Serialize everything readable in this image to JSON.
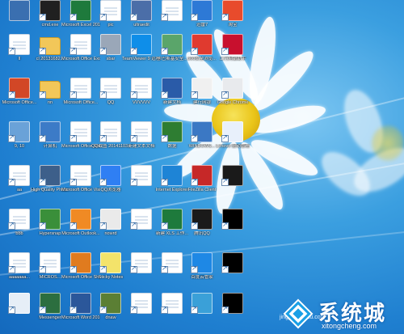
{
  "desktop": {
    "wallpaper": "Windows 8 daisy",
    "icons": [
      {
        "label": "",
        "kind": "app",
        "color": "#3a6fb0"
      },
      {
        "label": "cmd.exe",
        "kind": "app",
        "color": "#202020"
      },
      {
        "label": "Microsoft Excel 2010",
        "kind": "app",
        "color": "#1e7a3c"
      },
      {
        "label": "pic",
        "kind": "doc",
        "color": "#ffffff"
      },
      {
        "label": "ultraedit",
        "kind": "app",
        "color": "#4b6ea8"
      },
      {
        "label": "",
        "kind": "doc",
        "color": "#ffffff"
      },
      {
        "label": "迅雷7",
        "kind": "app",
        "color": "#2d79d6"
      },
      {
        "label": "淘宝",
        "kind": "app",
        "color": "#e84b2c"
      },
      {
        "label": "ll",
        "kind": "doc",
        "color": "#ffffff"
      },
      {
        "label": "cl 20131682...",
        "kind": "folder",
        "color": "#f2c759"
      },
      {
        "label": "Microsoft Office Excel...",
        "kind": "doc",
        "color": "#ffffff"
      },
      {
        "label": "sbar",
        "kind": "app",
        "color": "#9aa7b8"
      },
      {
        "label": "TeamViewer 9 远程...",
        "kind": "app",
        "color": "#0e8ee9"
      },
      {
        "label": "卡巴斯基安全...",
        "kind": "app",
        "color": "#5aa56a"
      },
      {
        "label": "360安全浏览...",
        "kind": "app",
        "color": "#e03a2f"
      },
      {
        "label": "工行网银助手",
        "kind": "app",
        "color": "#c8102e"
      },
      {
        "label": "Microsoft Office...",
        "kind": "app",
        "color": "#d24726"
      },
      {
        "label": "nn",
        "kind": "folder",
        "color": "#f2c759"
      },
      {
        "label": "Microsoft Office...",
        "kind": "doc",
        "color": "#ffffff"
      },
      {
        "label": "QQ",
        "kind": "doc",
        "color": "#ffffff"
      },
      {
        "label": "VVVVVV",
        "kind": "doc",
        "color": "#ffffff"
      },
      {
        "label": "新建文档",
        "kind": "app",
        "color": "#2a5ba8"
      },
      {
        "label": "建行网银",
        "kind": "app",
        "color": "#f0f0f0"
      },
      {
        "label": "Google Chrome",
        "kind": "app",
        "color": "#e8eaed"
      },
      {
        "label": "9, 10",
        "kind": "app",
        "color": "#6aa2d8"
      },
      {
        "label": "计算机",
        "kind": "app",
        "color": "#3c7bc7"
      },
      {
        "label": "Microsoft Office Sha...",
        "kind": "doc",
        "color": "#ffffff"
      },
      {
        "label": "QQ截图 20141103...",
        "kind": "doc",
        "color": "#ffffff"
      },
      {
        "label": "新建文本文档",
        "kind": "doc",
        "color": "#ffffff"
      },
      {
        "label": "数据",
        "kind": "app",
        "color": "#2e7d32"
      },
      {
        "label": "WINDOWS...",
        "kind": "app",
        "color": "#3b78c4"
      },
      {
        "label": "Lenovo 驱动管理",
        "kind": "app",
        "color": "#e8f0fb"
      },
      {
        "label": "aa",
        "kind": "doc",
        "color": "#ffffff"
      },
      {
        "label": "High Quality Photo Resiz...",
        "kind": "app",
        "color": "#3d5f8a"
      },
      {
        "label": "Microsoft Office Visio...",
        "kind": "doc",
        "color": "#ffffff"
      },
      {
        "label": "QQ浏览器",
        "kind": "app",
        "color": "#2f7ff3"
      },
      {
        "label": "",
        "kind": "doc",
        "color": "#ffffff"
      },
      {
        "label": "Internet Explorer",
        "kind": "app",
        "color": "#1e84d6"
      },
      {
        "label": "FileZilla Client",
        "kind": "app",
        "color": "#c62828"
      },
      {
        "label": "",
        "kind": "app",
        "color": "#1a1a1a"
      },
      {
        "label": "bbb",
        "kind": "doc",
        "color": "#ffffff"
      },
      {
        "label": "Hypersnap",
        "kind": "app",
        "color": "#3a8f3a"
      },
      {
        "label": "Microsoft Outlook...",
        "kind": "app",
        "color": "#f08a24"
      },
      {
        "label": "nowrd",
        "kind": "app",
        "color": "#eaeaea"
      },
      {
        "label": "",
        "kind": "doc",
        "color": "#ffffff"
      },
      {
        "label": "新建 XLS 工作...",
        "kind": "app",
        "color": "#1e7a3c"
      },
      {
        "label": "腾讯QQ",
        "kind": "app",
        "color": "#1a1a1a"
      },
      {
        "label": "",
        "kind": "app",
        "color": "#000000"
      },
      {
        "label": "aaaaaaa...",
        "kind": "doc",
        "color": "#ffffff"
      },
      {
        "label": "MICROS...",
        "kind": "doc",
        "color": "#ffffff"
      },
      {
        "label": "Microsoft Office Share...",
        "kind": "app",
        "color": "#e07b1f"
      },
      {
        "label": "Sticky Notes",
        "kind": "app",
        "color": "#f3e36a"
      },
      {
        "label": "",
        "kind": "doc",
        "color": "#ffffff"
      },
      {
        "label": "",
        "kind": "doc",
        "color": "#ffffff"
      },
      {
        "label": "百度云管家",
        "kind": "app",
        "color": "#1e88e5"
      },
      {
        "label": "",
        "kind": "app",
        "color": "#000000"
      },
      {
        "label": "",
        "kind": "app",
        "color": "#e6eef7"
      },
      {
        "label": "Messenger",
        "kind": "app",
        "color": "#2c6e3f"
      },
      {
        "label": "Microsoft Word 2010",
        "kind": "app",
        "color": "#2b579a"
      },
      {
        "label": "dnaw",
        "kind": "app",
        "color": "#5b7f34"
      },
      {
        "label": "",
        "kind": "doc",
        "color": "#ffffff"
      },
      {
        "label": "",
        "kind": "doc",
        "color": "#ffffff"
      },
      {
        "label": "",
        "kind": "app",
        "color": "#3aa0d8"
      },
      {
        "label": "",
        "kind": "app",
        "color": "#000000"
      }
    ]
  },
  "watermark": {
    "brand": "系统城",
    "domain": "xitongcheng.com",
    "sub": "jingyan.baidu.com"
  }
}
